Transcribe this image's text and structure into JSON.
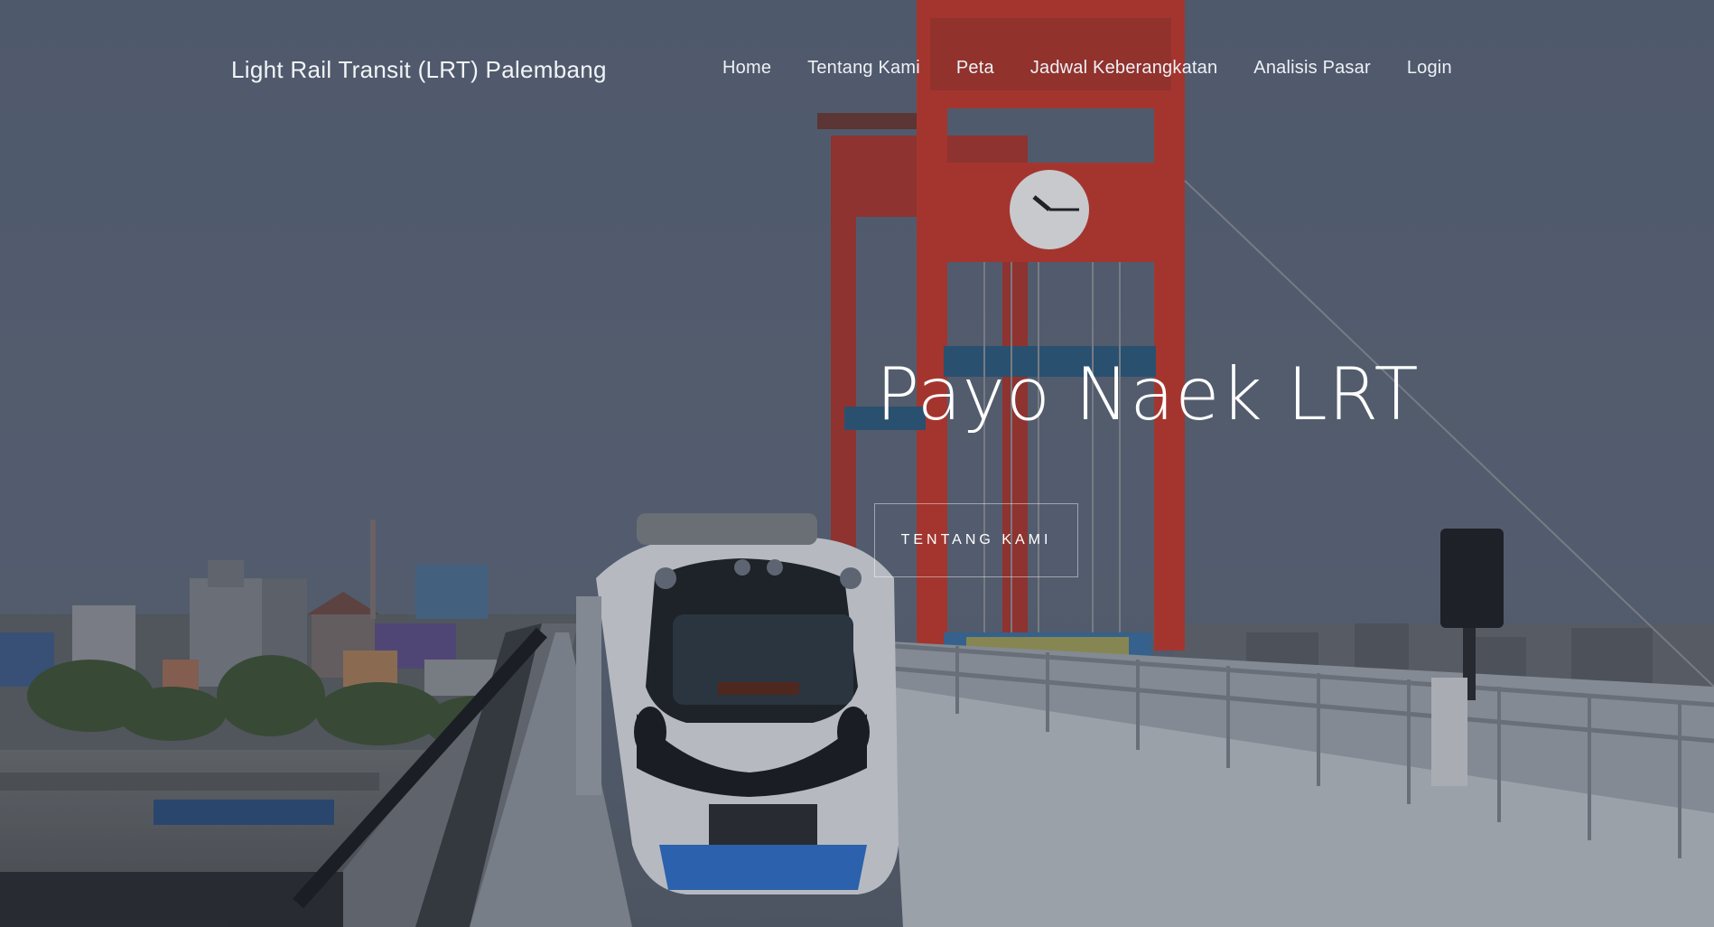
{
  "navbar": {
    "brand": "Light Rail Transit (LRT) Palembang",
    "items": [
      {
        "label": "Home"
      },
      {
        "label": "Tentang Kami"
      },
      {
        "label": "Peta"
      },
      {
        "label": "Jadwal Keberangkatan"
      },
      {
        "label": "Analisis Pasar"
      },
      {
        "label": "Login"
      }
    ]
  },
  "hero": {
    "title": "Payo Naek LRT",
    "button_label": "TENTANG KAMI"
  },
  "colors": {
    "overlay": "#4a5566",
    "bridge_red": "#c23a2e",
    "text": "#ffffff"
  }
}
